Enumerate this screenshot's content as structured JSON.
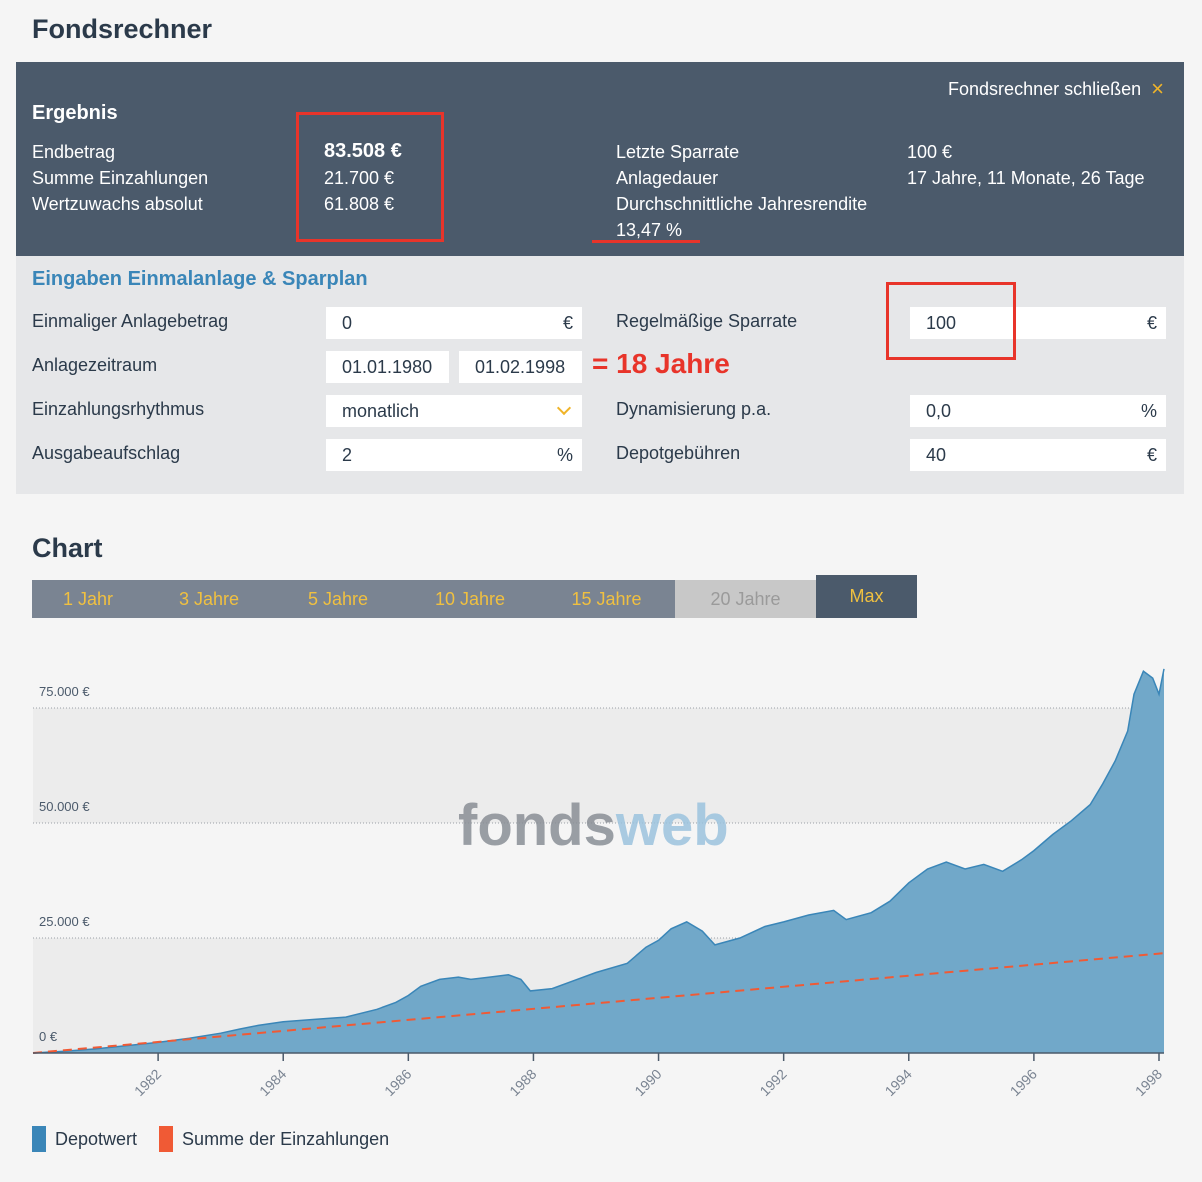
{
  "page_title": "Fondsrechner",
  "result": {
    "close_label": "Fondsrechner schließen",
    "close_icon": "×",
    "heading": "Ergebnis",
    "left": [
      {
        "label": "Endbetrag",
        "value": "83.508 €"
      },
      {
        "label": "Summe Einzahlungen",
        "value": "21.700 €"
      },
      {
        "label": "Wertzuwachs absolut",
        "value": "61.808 €"
      }
    ],
    "right": [
      {
        "label": "Letzte Sparrate",
        "value": "100 €"
      },
      {
        "label": "Anlagedauer",
        "value": "17 Jahre, 11 Monate, 26 Tage"
      },
      {
        "label": "Durchschnittliche Jahresrendite",
        "value": "13,47 %"
      }
    ]
  },
  "inputs": {
    "heading": "Eingaben Einmalanlage & Sparplan",
    "one_time_label": "Einmaliger Anlagebetrag",
    "one_time_value": "0",
    "one_time_unit": "€",
    "period_label": "Anlagezeitraum",
    "period_start": "01.01.1980",
    "period_end": "01.02.1998",
    "period_note": "= 18 Jahre",
    "rhythm_label": "Einzahlungsrhythmus",
    "rhythm_value": "monatlich",
    "fee_label": "Ausgabeaufschlag",
    "fee_value": "2",
    "fee_unit": "%",
    "rate_label": "Regelmäßige Sparrate",
    "rate_value": "100",
    "rate_unit": "€",
    "dyn_label": "Dynamisierung p.a.",
    "dyn_value": "0,0",
    "dyn_unit": "%",
    "depot_label": "Depotgebühren",
    "depot_value": "40",
    "depot_unit": "€"
  },
  "chart_section": {
    "title": "Chart",
    "tabs": [
      {
        "label": "1 Jahr",
        "state": "normal"
      },
      {
        "label": "3 Jahre",
        "state": "normal"
      },
      {
        "label": "5 Jahre",
        "state": "normal"
      },
      {
        "label": "10 Jahre",
        "state": "normal"
      },
      {
        "label": "15 Jahre",
        "state": "normal"
      },
      {
        "label": "20 Jahre",
        "state": "disabled"
      },
      {
        "label": "Max",
        "state": "active"
      }
    ],
    "watermark_a": "fonds",
    "watermark_b": "web",
    "legend": [
      {
        "label": "Depotwert",
        "color": "#3a86b8"
      },
      {
        "label": "Summe der Einzahlungen",
        "color": "#f05a35"
      }
    ]
  },
  "colors": {
    "header_bg": "#4b5a6b",
    "accent_yellow": "#f0b429",
    "accent_red": "#e8342a",
    "area_fill": "#71a8c9",
    "area_line": "#3a86b8",
    "dashed_line": "#f05a35"
  },
  "chart_data": {
    "type": "area",
    "title": "",
    "xlabel": "",
    "ylabel": "",
    "x_ticks": [
      "1982",
      "1984",
      "1986",
      "1988",
      "1990",
      "1992",
      "1994",
      "1996",
      "1998"
    ],
    "y_ticks": [
      "0 €",
      "25.000 €",
      "50.000 €",
      "75.000 €"
    ],
    "xlim": [
      1980.0,
      1998.08
    ],
    "ylim": [
      0,
      80000
    ],
    "series": [
      {
        "name": "Depotwert",
        "type": "area",
        "x": [
          1980.0,
          1980.5,
          1981.0,
          1981.5,
          1982.0,
          1982.5,
          1983.0,
          1983.3,
          1983.6,
          1984.0,
          1984.5,
          1985.0,
          1985.5,
          1985.8,
          1986.0,
          1986.2,
          1986.5,
          1986.8,
          1987.0,
          1987.3,
          1987.6,
          1987.8,
          1987.95,
          1988.3,
          1988.6,
          1989.0,
          1989.5,
          1989.8,
          1990.0,
          1990.2,
          1990.45,
          1990.7,
          1990.9,
          1991.3,
          1991.7,
          1992.0,
          1992.4,
          1992.8,
          1993.0,
          1993.4,
          1993.7,
          1994.0,
          1994.3,
          1994.6,
          1994.9,
          1995.2,
          1995.5,
          1995.8,
          1996.0,
          1996.3,
          1996.6,
          1996.9,
          1997.1,
          1997.3,
          1997.5,
          1997.6,
          1997.75,
          1997.9,
          1998.0,
          1998.08
        ],
        "y": [
          0,
          400,
          900,
          1600,
          2300,
          3200,
          4300,
          5200,
          6000,
          6800,
          7300,
          7800,
          9500,
          11000,
          12500,
          14500,
          16000,
          16500,
          16000,
          16500,
          17000,
          16000,
          13500,
          14000,
          15500,
          17500,
          19500,
          23000,
          24500,
          27000,
          28500,
          26500,
          23500,
          25000,
          27500,
          28500,
          30000,
          31000,
          29000,
          30500,
          33000,
          37000,
          40000,
          41500,
          40000,
          41000,
          39500,
          42000,
          44000,
          47500,
          50500,
          54000,
          58500,
          63500,
          70000,
          78000,
          83000,
          81500,
          78000,
          83508
        ]
      },
      {
        "name": "Summe der Einzahlungen",
        "type": "line",
        "style": "dashed",
        "x": [
          1980.0,
          1998.08
        ],
        "y": [
          0,
          21700
        ]
      }
    ]
  }
}
